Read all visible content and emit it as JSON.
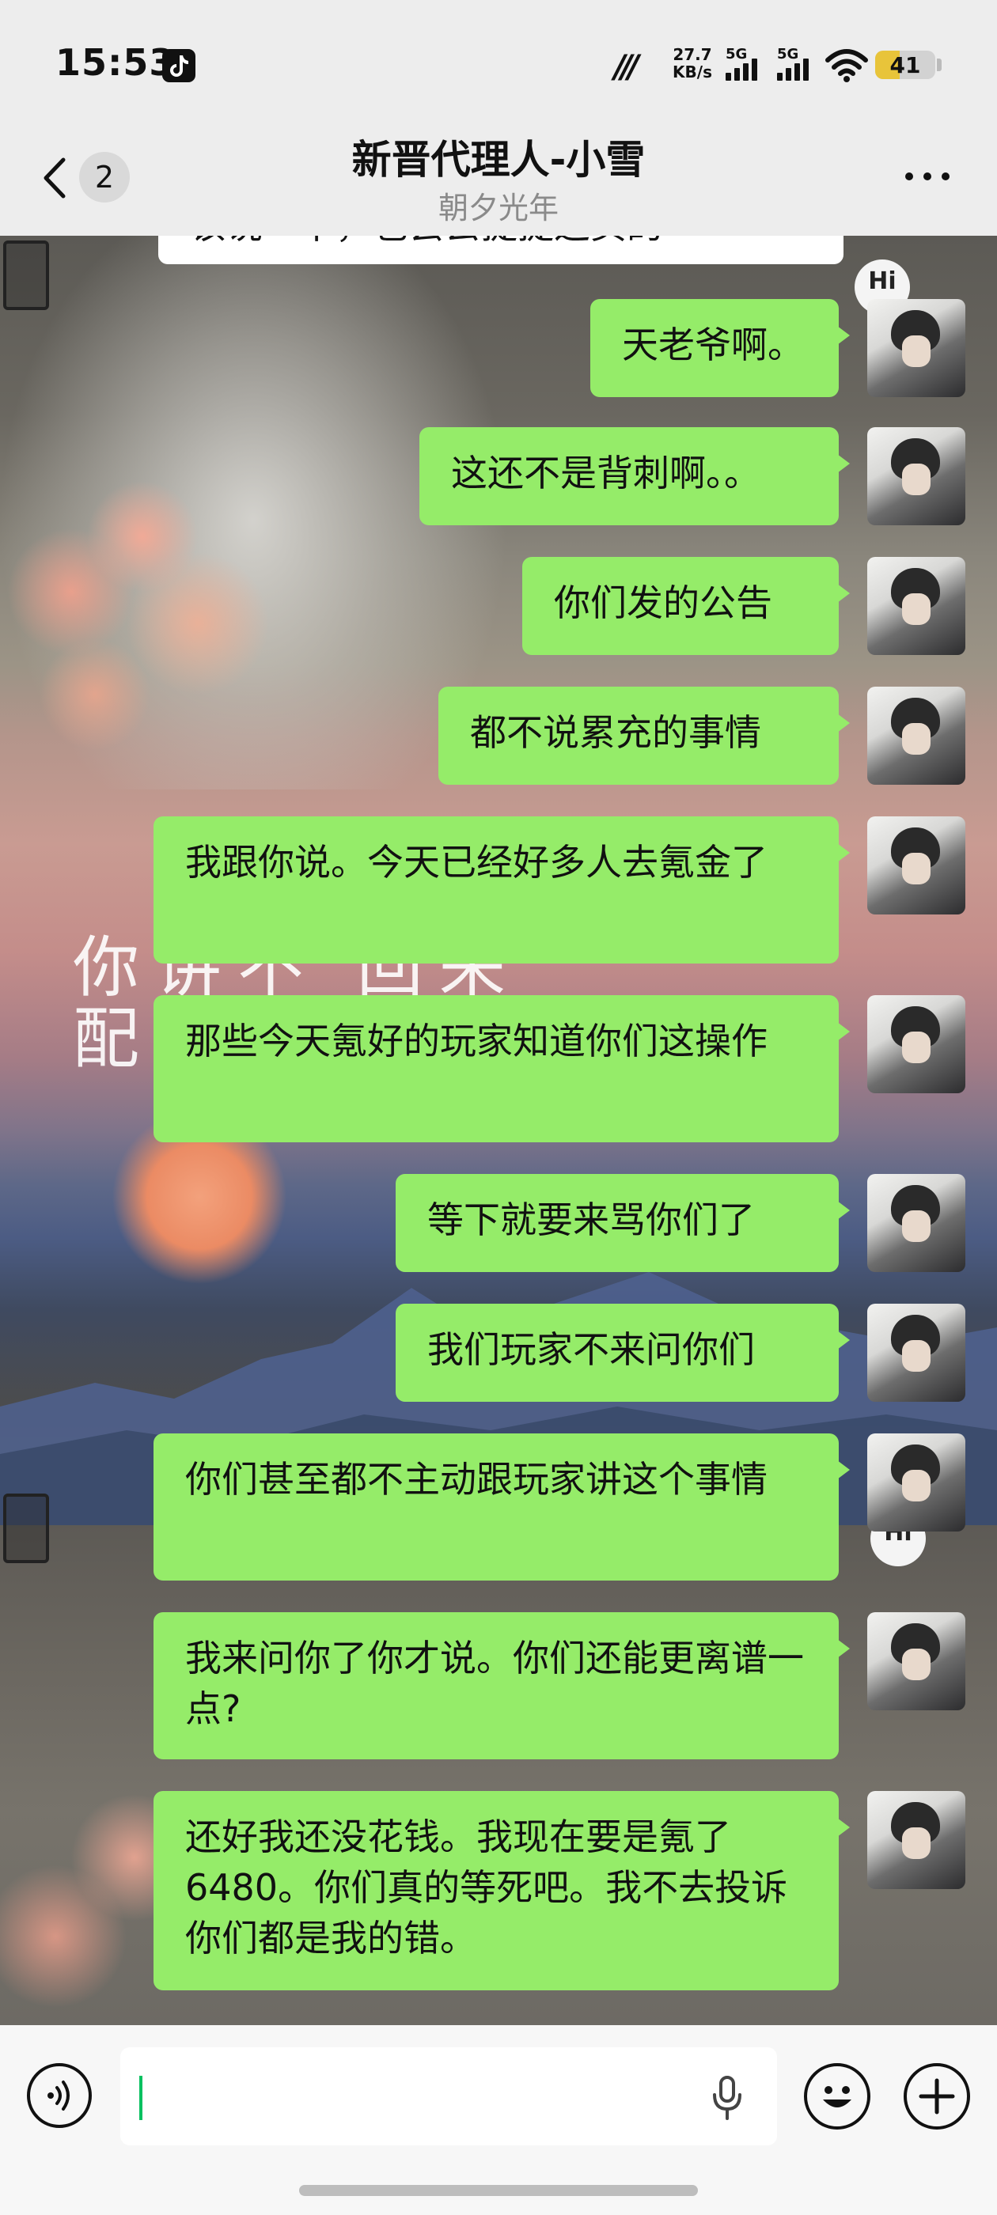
{
  "status_bar": {
    "time": "15:53",
    "network_speed": "27.7",
    "network_speed_unit": "KB/s",
    "signal_1_label": "5G",
    "signal_2_label": "5G",
    "battery_level": "41",
    "battery_fraction": 0.41,
    "icons": [
      "tiktok-icon",
      "m-icon",
      "signal-icon",
      "wifi-icon",
      "battery-icon"
    ]
  },
  "nav": {
    "back_badge": "2",
    "title": "新晋代理人-小雪",
    "subtitle": "朝夕光年",
    "icons": [
      "chevron-left-icon",
      "more-icon"
    ]
  },
  "background": {
    "calligraphy": [
      "你讲不 回来",
      "配"
    ]
  },
  "messages": [
    {
      "text": "天老爷啊。"
    },
    {
      "text": "这还不是背刺啊。。"
    },
    {
      "text": "你们发的公告"
    },
    {
      "text": "都不说累充的事情"
    },
    {
      "text": "我跟你说。今天已经好多人去氪金了"
    },
    {
      "text": "那些今天氪好的玩家知道你们这操作"
    },
    {
      "text": "等下就要来骂你们了"
    },
    {
      "text": "我们玩家不来问你们"
    },
    {
      "text": "你们甚至都不主动跟玩家讲这个事情"
    },
    {
      "text": "我来问你了你才说。你们还能更离谱一点?"
    },
    {
      "text": "还好我还没花钱。我现在要是氪了6480。你们真的等死吧。我不去投诉你们都是我的错。"
    }
  ],
  "partial_message": {
    "text": "该说一下，也会去提提这页的"
  },
  "input_bar": {
    "text_value": "",
    "icons": [
      "voice-icon",
      "microphone-icon",
      "emoji-icon",
      "plus-icon"
    ]
  },
  "colors": {
    "bubble_self": "#95ec69",
    "caret": "#07c160",
    "header_bg": "#ededed",
    "input_bg": "#f7f7f7"
  }
}
